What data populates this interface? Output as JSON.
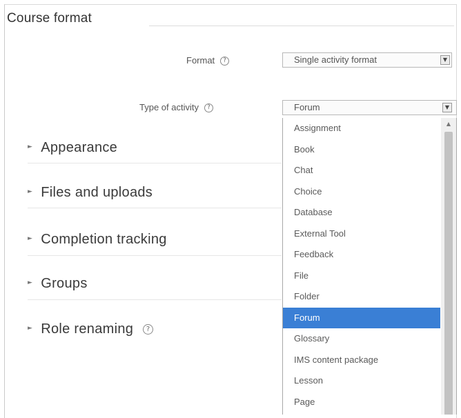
{
  "section": {
    "title": "Course format"
  },
  "format_field": {
    "label": "Format",
    "help_icon": "help-icon",
    "value": "Single activity format"
  },
  "activity_field": {
    "label": "Type of activity",
    "help_icon": "help-icon",
    "value": "Forum"
  },
  "collapsibles": [
    {
      "label": "Appearance"
    },
    {
      "label": "Files and uploads"
    },
    {
      "label": "Completion tracking"
    },
    {
      "label": "Groups"
    },
    {
      "label": "Role renaming"
    }
  ],
  "dropdown": {
    "options": [
      "Assignment",
      "Book",
      "Chat",
      "Choice",
      "Database",
      "External Tool",
      "Feedback",
      "File",
      "Folder",
      "Forum",
      "Glossary",
      "IMS content package",
      "Lesson",
      "Page"
    ],
    "selected": "Forum",
    "selected_color": "#3a7fd5"
  },
  "icons": {
    "help": "?",
    "select_arrow": "▼",
    "caret": "►",
    "scroll_up": "▲"
  }
}
